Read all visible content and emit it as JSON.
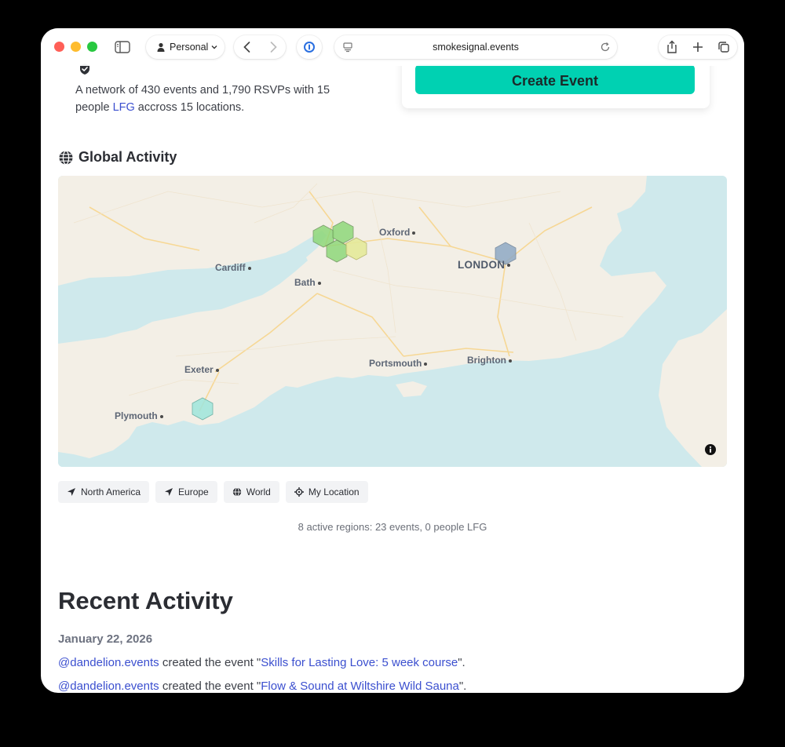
{
  "browser": {
    "profile_label": "Personal",
    "url": "smokesignal.events"
  },
  "stats": {
    "prefix": "A network of 430 events and 1,790 RSVPs with 15 people ",
    "lfg_link": "LFG",
    "suffix": " accross 15 locations."
  },
  "create_event_label": "Create Event",
  "global_activity": {
    "title": "Global Activity",
    "cities": {
      "oxford": "Oxford",
      "cardiff": "Cardiff",
      "bath": "Bath",
      "london": "LONDON",
      "exeter": "Exeter",
      "portsmouth": "Portsmouth",
      "brighton": "Brighton",
      "plymouth": "Plymouth"
    },
    "region_buttons": [
      "North America",
      "Europe",
      "World",
      "My Location"
    ],
    "summary": "8 active regions: 23 events, 0 people LFG",
    "colors": {
      "green": "#8fd87a",
      "yellow": "#e5ea9a",
      "blue": "#8fa9c4",
      "teal": "#9fe6dc",
      "water": "#cfe9ec",
      "land": "#f3efe6"
    }
  },
  "recent_activity": {
    "title": "Recent Activity",
    "date": "January 22, 2026",
    "items": [
      {
        "actor": "@dandelion.events",
        "verb": " created the event \"",
        "event": "Skills for Lasting Love: 5 week course",
        "end": "\"."
      },
      {
        "actor": "@dandelion.events",
        "verb": " created the event \"",
        "event": "Flow & Sound at Wiltshire Wild Sauna",
        "end": "\"."
      }
    ]
  }
}
